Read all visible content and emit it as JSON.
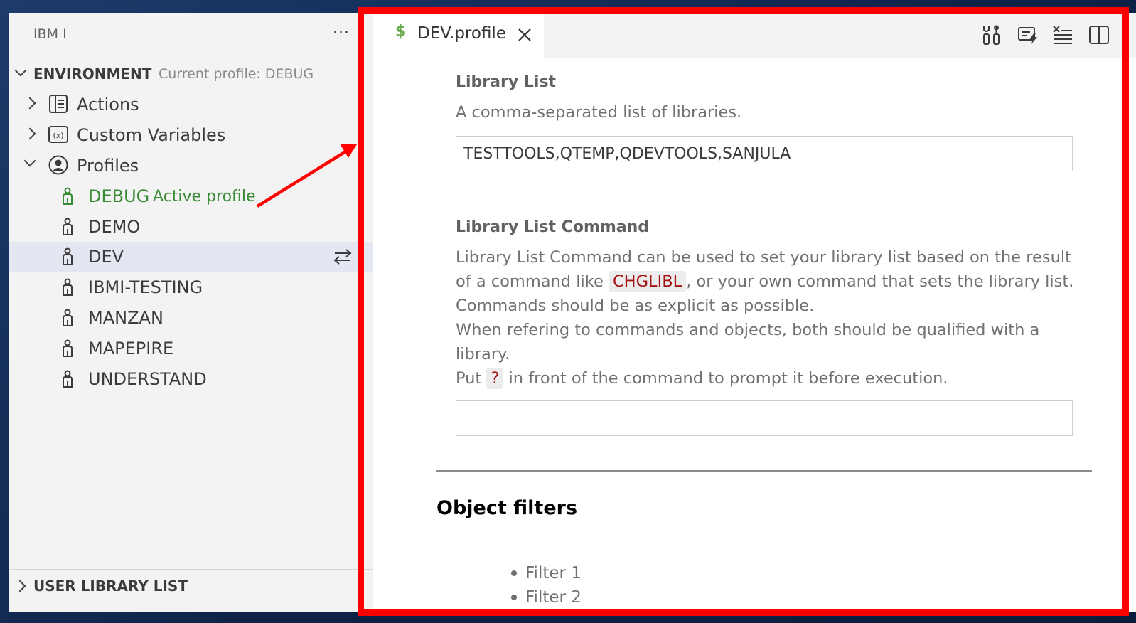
{
  "sidebar": {
    "title": "IBM I",
    "more_label": "···",
    "environment": {
      "title": "ENVIRONMENT",
      "description": "Current profile: DEBUG"
    },
    "items": [
      {
        "label": "Actions",
        "icon": "notebook-icon"
      },
      {
        "label": "Custom Variables",
        "icon": "symbol-variable-icon"
      },
      {
        "label": "Profiles",
        "icon": "account-icon"
      }
    ],
    "profiles": [
      {
        "label": "DEBUG",
        "tag": "Active profile"
      },
      {
        "label": "DEMO"
      },
      {
        "label": "DEV"
      },
      {
        "label": "IBMI-TESTING"
      },
      {
        "label": "MANZAN"
      },
      {
        "label": "MAPEPIRE"
      },
      {
        "label": "UNDERSTAND"
      }
    ],
    "user_library_list": "USER LIBRARY LIST"
  },
  "editor": {
    "tab": {
      "icon_glyph": "$",
      "label": "DEV.profile"
    },
    "toolbar": [
      "tools-icon",
      "run-icon",
      "list-icon",
      "split-editor-icon"
    ],
    "library_list": {
      "title": "Library List",
      "description": "A comma-separated list of libraries.",
      "value": "TESTTOOLS,QTEMP,QDEVTOOLS,SANJULA"
    },
    "library_list_command": {
      "title": "Library List Command",
      "desc_1a": "Library List Command can be used to set your library list based on the result of a command like ",
      "desc_1_code": "CHGLIBL",
      "desc_1b": ", or your own command that sets the library list.",
      "desc_2": "Commands should be as explicit as possible.",
      "desc_3": "When refering to commands and objects, both should be qualified with a library.",
      "desc_4a": "Put ",
      "desc_4_code": "?",
      "desc_4b": " in front of the command to prompt it before execution.",
      "value": ""
    },
    "object_filters": {
      "title": "Object filters",
      "items": [
        "Filter 1",
        "Filter 2"
      ]
    }
  },
  "colors": {
    "active_profile": "#388a34",
    "selected_row": "#e4e6f1",
    "annotation": "#ff0000",
    "inline_code": "#a31515"
  }
}
